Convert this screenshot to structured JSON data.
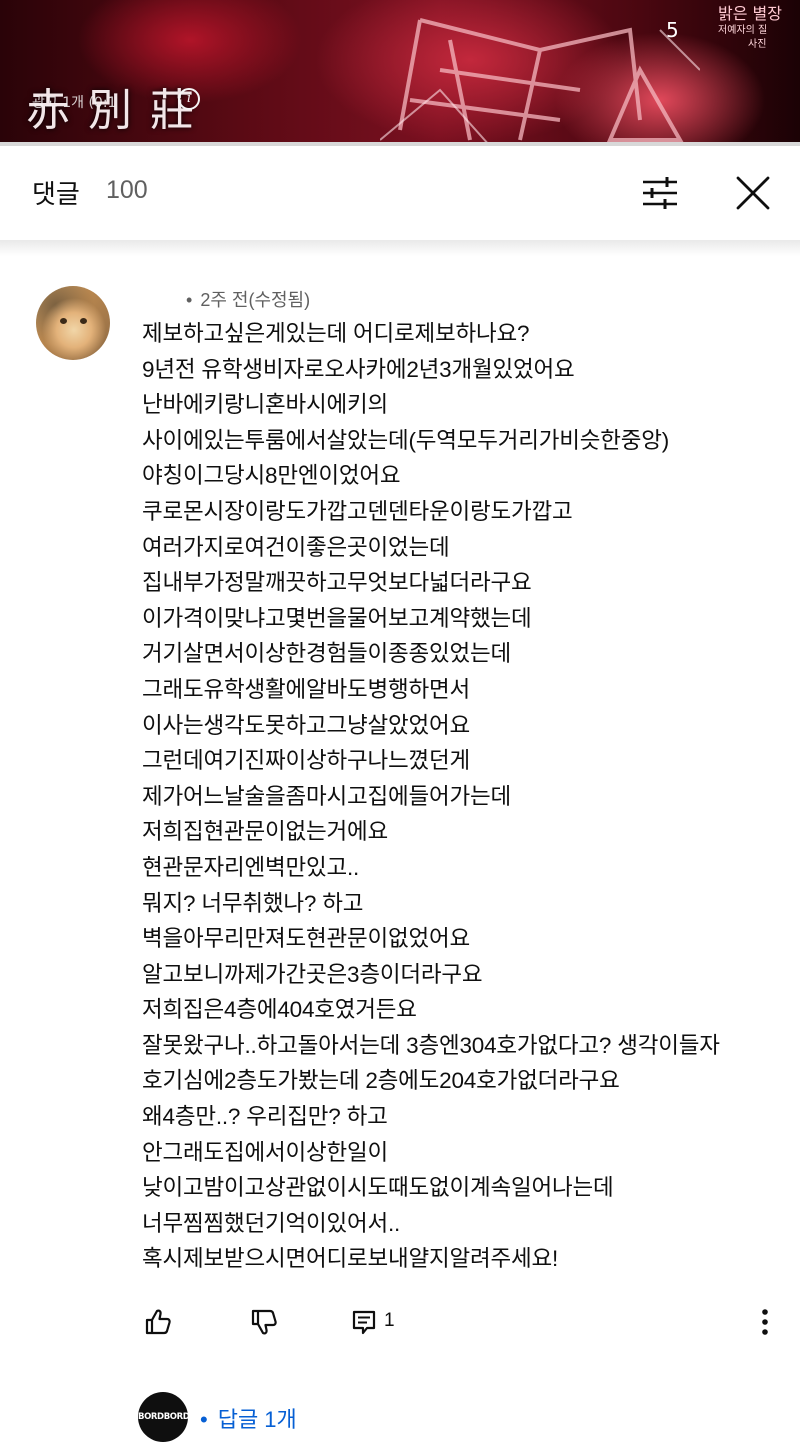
{
  "video": {
    "logo_text": "赤 別 莊",
    "caption": "광고 1개 (0:1",
    "info_icon": "info-icon",
    "counter": "5",
    "channel_art_lines": [
      "밝은 별장",
      "저예자의 질",
      "사진"
    ],
    "progress_fraction": 0.0,
    "colors": {
      "progress_bg": "#d8d8d8"
    }
  },
  "comments_panel": {
    "title": "댓글",
    "count": "100",
    "sort_icon": "sort-filter-icon",
    "close_icon": "close-icon"
  },
  "comment": {
    "avatar": "cat-avatar",
    "meta_dot": "•",
    "meta": "2주 전(수정됨)",
    "lines": [
      "제보하고싶은게있는데 어디로제보하나요?",
      "9년전 유학생비자로오사카에2년3개월있었어요",
      "난바에키랑니혼바시에키의",
      "사이에있는투룸에서살았는데(두역모두거리가비슷한중앙)",
      "야칭이그당시8만엔이었어요",
      "쿠로몬시장이랑도가깝고덴덴타운이랑도가깝고",
      "여러가지로여건이좋은곳이었는데",
      "집내부가정말깨끗하고무엇보다넓더라구요",
      "이가격이맞냐고몇번을물어보고계약했는데",
      "거기살면서이상한경험들이종종있었는데",
      "그래도유학생활에알바도병행하면서",
      "이사는생각도못하고그냥살았었어요",
      "그런데여기진짜이상하구나느꼈던게",
      "제가어느날술을좀마시고집에들어가는데",
      "저희집현관문이없는거에요",
      "현관문자리엔벽만있고..",
      "뭐지? 너무취했나? 하고",
      "벽을아무리만져도현관문이없었어요",
      "알고보니까제가간곳은3층이더라구요",
      "저희집은4층에404호였거든요",
      "잘못왔구나..하고돌아서는데 3층엔304호가없다고? 생각이들자",
      "호기심에2층도가봤는데 2층에도204호가없더라구요",
      "왜4층만..? 우리집만? 하고",
      "안그래도집에서이상한일이",
      "낮이고밤이고상관없이시도때도없이계속일어나는데",
      "너무찜찜했던기억이있어서..",
      "혹시제보받으시면어디로보내얄지알려주세요!"
    ],
    "actions": {
      "like_icon": "thumbs-up-icon",
      "dislike_icon": "thumbs-down-icon",
      "reply_icon": "reply-icon",
      "reply_count": "1",
      "more_icon": "more-vertical-icon"
    },
    "replies": {
      "creator_badge": "BORDBORD",
      "dot": "•",
      "label": "답글 1개",
      "link_color": "#065fd4"
    }
  }
}
